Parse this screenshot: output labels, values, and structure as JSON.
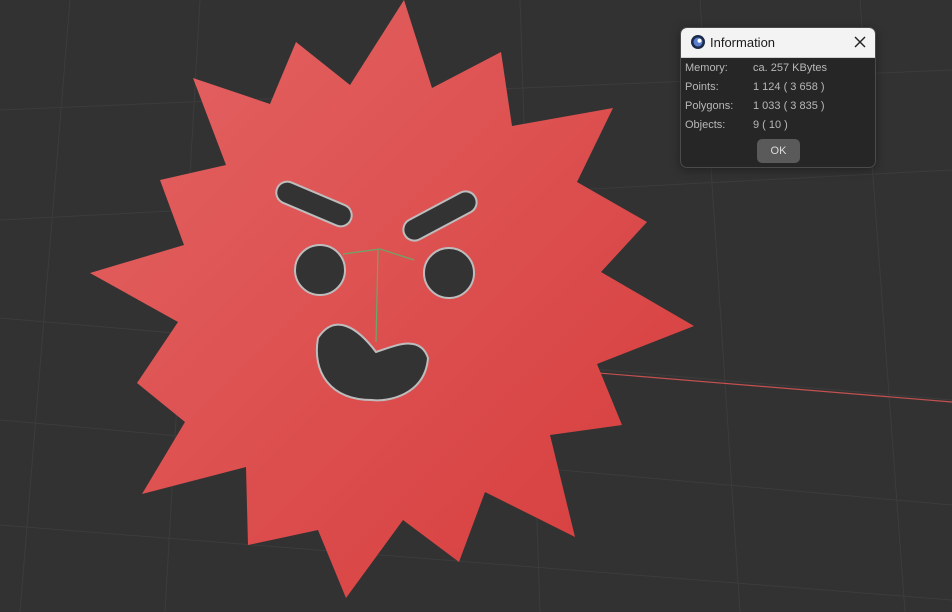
{
  "dialog": {
    "title": "Information",
    "close_icon": "close-icon",
    "app_icon": "cinema4d-app-icon",
    "rows": [
      {
        "label": "Memory:",
        "value": "ca. 257 KBytes"
      },
      {
        "label": "Points:",
        "value": "1 124 ( 3 658 )"
      },
      {
        "label": "Polygons:",
        "value": "1 033 ( 3 835 )"
      },
      {
        "label": "Objects:",
        "value": "9 ( 10 )"
      }
    ],
    "ok_label": "OK"
  },
  "viewport": {
    "background_color": "#323232",
    "grid_color": "#3d3d3d",
    "object_color": "#dd4a4a",
    "axis_x_color": "#c45050",
    "axis_y_color": "#6aa86a"
  }
}
